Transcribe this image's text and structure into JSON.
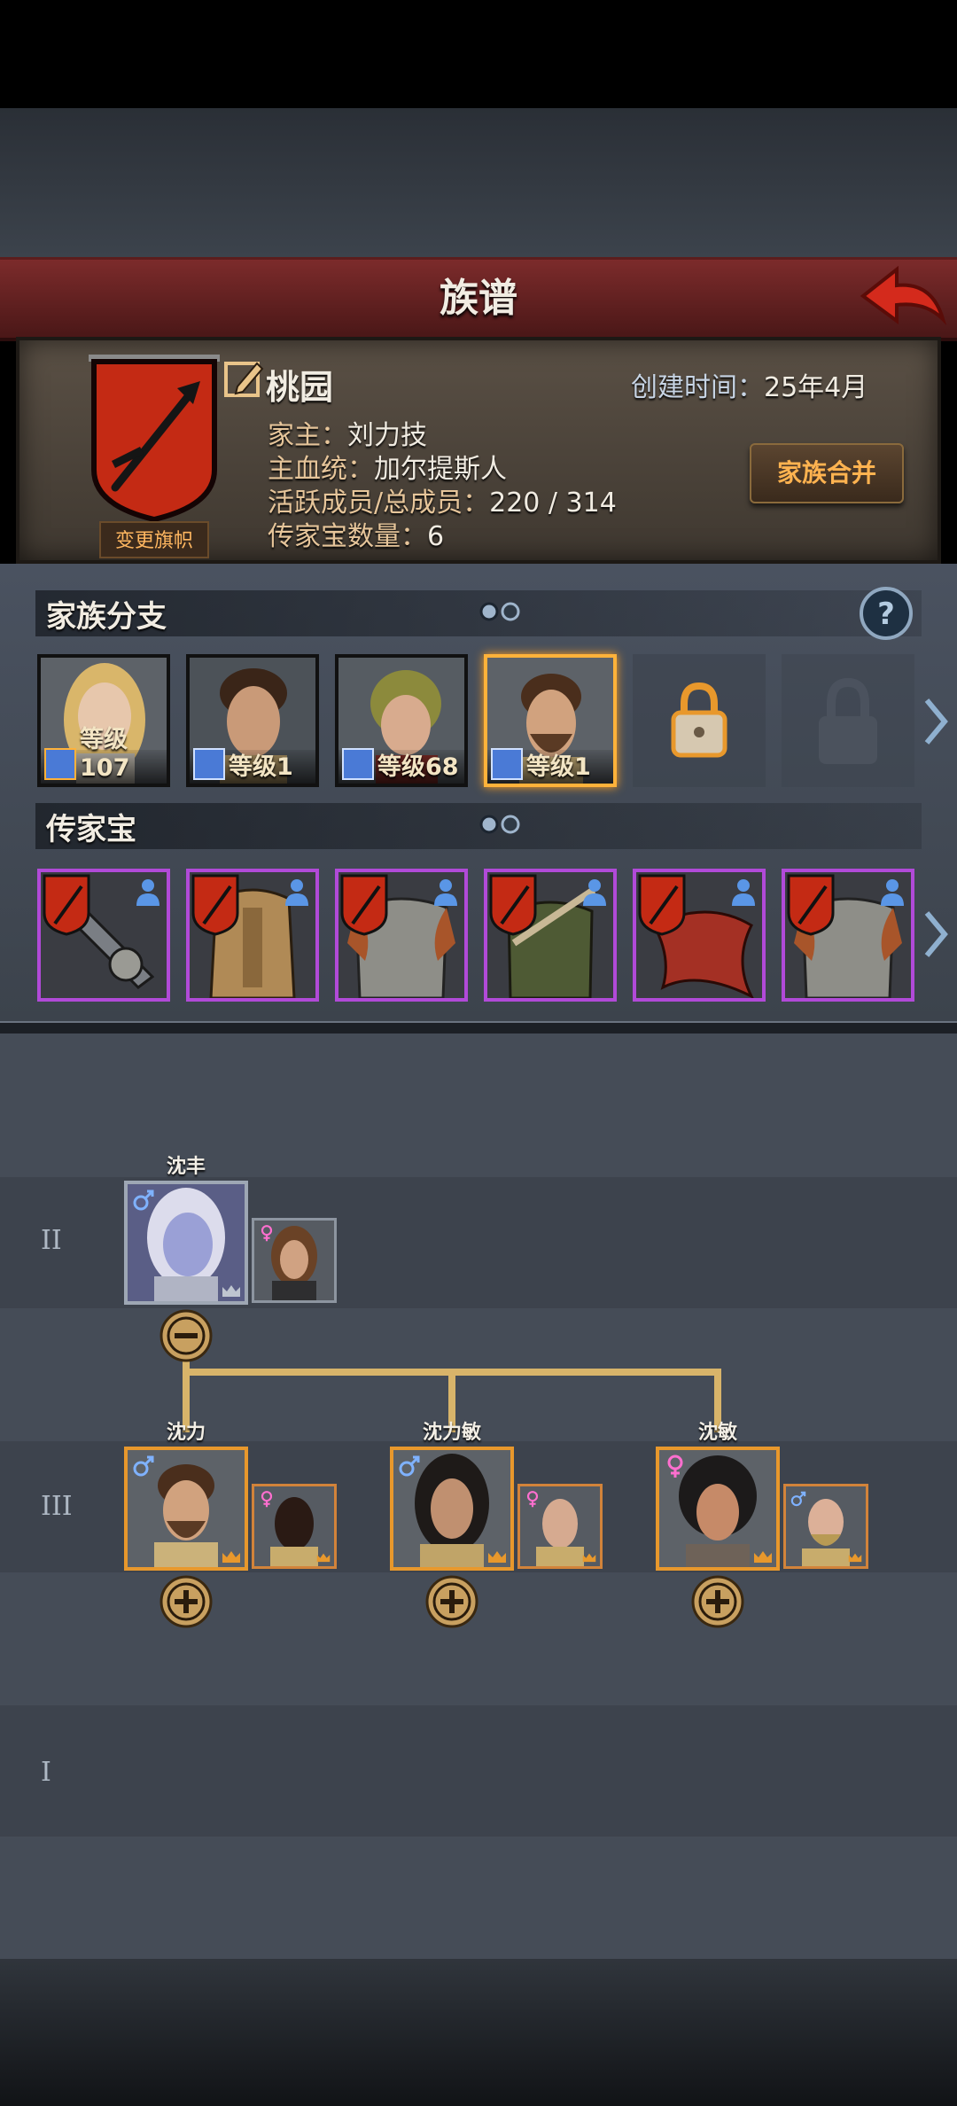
{
  "header": {
    "title": "族谱"
  },
  "family": {
    "name": "桃园",
    "change_flag_label": "变更旗帜",
    "created_label": "创建时间：",
    "created_value": "25年4月",
    "head_label": "家主：",
    "head_value": "刘力技",
    "bloodline_label": "主血统：",
    "bloodline_value": "加尔提斯人",
    "members_label": "活跃成员/总成员：",
    "members_value": "220 / 314",
    "heirloom_count_label": "传家宝数量：",
    "heirloom_count_value": "6",
    "merge_label": "家族合并",
    "banner_color": "#c42a14"
  },
  "branches": {
    "title": "家族分支",
    "members": [
      {
        "level": "等级107",
        "selected": false
      },
      {
        "level": "等级1",
        "selected": false
      },
      {
        "level": "等级68",
        "selected": false
      },
      {
        "level": "等级1",
        "selected": true
      }
    ],
    "locked_slots": 2
  },
  "heirlooms": {
    "title": "传家宝",
    "items": [
      "sword-item",
      "bronze-armor-item",
      "chainmail-item",
      "green-coat-item",
      "red-cloak-item",
      "chainmail-item-2"
    ],
    "rarity_color": "#b14ad8"
  },
  "tree": {
    "generations": [
      {
        "label": "II"
      },
      {
        "label": "III"
      },
      {
        "label": "I"
      }
    ],
    "gen2": {
      "name": "沈丰"
    },
    "gen3": [
      {
        "name": "沈力"
      },
      {
        "name": "沈力敏"
      },
      {
        "name": "沈敏"
      }
    ]
  }
}
